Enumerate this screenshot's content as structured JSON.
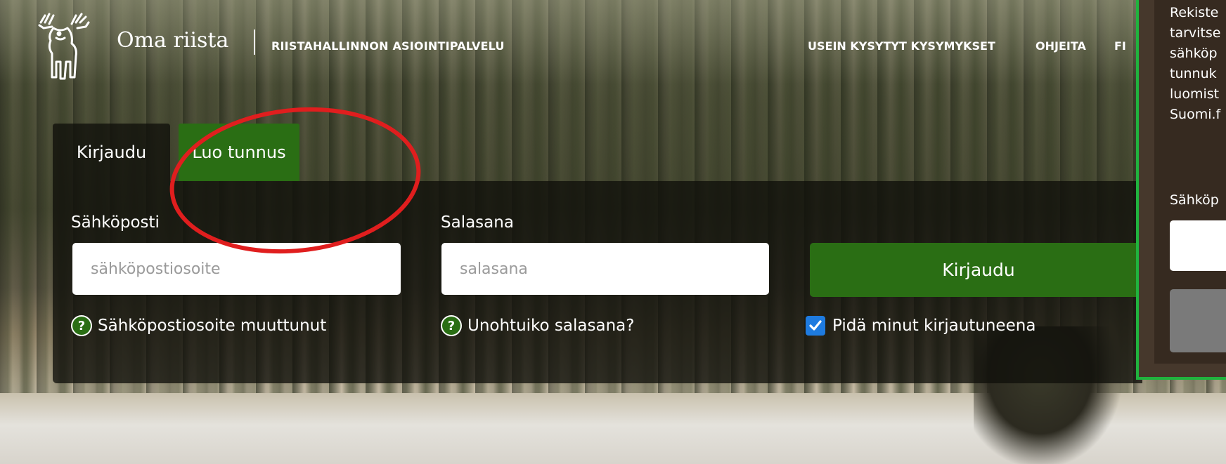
{
  "header": {
    "brand": "Oma riista",
    "subtitle": "RIISTAHALLINNON ASIOINTIPALVELU",
    "nav": {
      "faq": "USEIN KYSYTYT KYSYMYKSET",
      "help": "OHJEITA",
      "lang": "FI"
    },
    "logo_icon": "moose-logo-icon"
  },
  "tabs": [
    {
      "label": "Kirjaudu",
      "active": true
    },
    {
      "label": "Luo tunnus",
      "active": false
    }
  ],
  "login_form": {
    "email_label": "Sähköposti",
    "email_placeholder": "sähköpostiosoite",
    "email_value": "",
    "password_label": "Salasana",
    "password_placeholder": "salasana",
    "password_value": "",
    "login_button": "Kirjaudu",
    "email_changed_link": "Sähköpostiosoite muuttunut",
    "forgot_password_link": "Unohtuiko salasana?",
    "remember_me_label": "Pidä minut kirjautuneena",
    "remember_me_checked": true
  },
  "side_panel": {
    "text_lines": [
      "Rekiste",
      "tarvitse",
      "sähköp",
      "tunnuk",
      "luomist",
      "Suomi.f"
    ],
    "email_label": "Sähköp"
  },
  "colors": {
    "primary_green": "#2a6e14",
    "annotation_red": "#e01e1e",
    "side_border": "#20b33e",
    "checkbox_blue": "#1e7be0"
  }
}
